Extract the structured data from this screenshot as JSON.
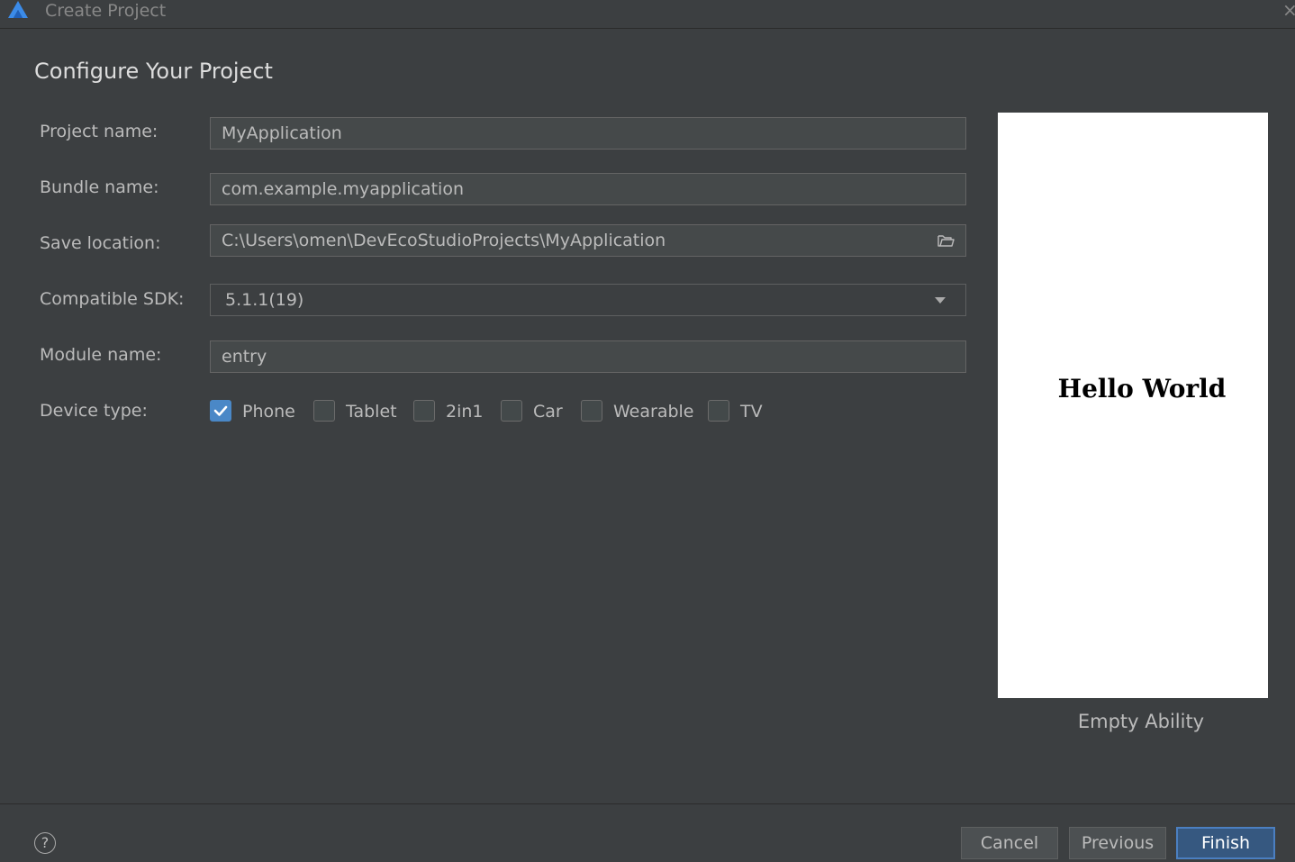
{
  "window": {
    "title": "Create Project",
    "close_glyph": "×"
  },
  "page": {
    "title": "Configure Your Project"
  },
  "form": {
    "project_name": {
      "label": "Project name:",
      "value": "MyApplication"
    },
    "bundle_name": {
      "label": "Bundle name:",
      "value": "com.example.myapplication"
    },
    "save_location": {
      "label": "Save location:",
      "value": "C:\\Users\\omen\\DevEcoStudioProjects\\MyApplication"
    },
    "compatible_sdk": {
      "label": "Compatible SDK:",
      "value": "5.1.1(19)"
    },
    "module_name": {
      "label": "Module name:",
      "value": "entry"
    },
    "device_type": {
      "label": "Device type:",
      "options": [
        {
          "label": "Phone",
          "checked": true
        },
        {
          "label": "Tablet",
          "checked": false
        },
        {
          "label": "2in1",
          "checked": false
        },
        {
          "label": "Car",
          "checked": false
        },
        {
          "label": "Wearable",
          "checked": false
        },
        {
          "label": "TV",
          "checked": false
        }
      ]
    }
  },
  "preview": {
    "text": "Hello World",
    "caption": "Empty Ability"
  },
  "footer": {
    "help_glyph": "?",
    "cancel": "Cancel",
    "previous": "Previous",
    "finish": "Finish"
  },
  "colors": {
    "background": "#3c3f41",
    "accent": "#4a88c7",
    "primary_button": "#365880"
  }
}
